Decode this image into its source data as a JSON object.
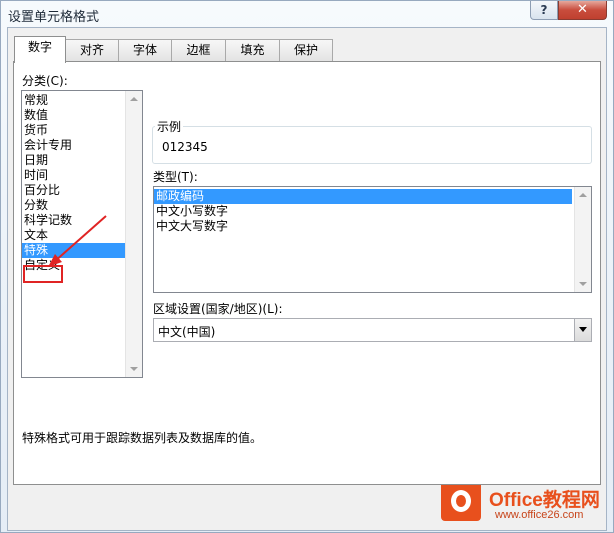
{
  "window": {
    "title": "设置单元格格式",
    "help_glyph": "?",
    "close_glyph": "✕"
  },
  "tabs": [
    {
      "label": "数字",
      "active": true
    },
    {
      "label": "对齐"
    },
    {
      "label": "字体"
    },
    {
      "label": "边框"
    },
    {
      "label": "填充"
    },
    {
      "label": "保护"
    }
  ],
  "category": {
    "label": "分类(C):",
    "items": [
      "常规",
      "数值",
      "货币",
      "会计专用",
      "日期",
      "时间",
      "百分比",
      "分数",
      "科学记数",
      "文本",
      "特殊",
      "自定义"
    ],
    "selected": "特殊"
  },
  "sample": {
    "label": "示例",
    "value": "012345"
  },
  "type": {
    "label": "类型(T):",
    "items": [
      "邮政编码",
      "中文小写数字",
      "中文大写数字"
    ],
    "selected": "邮政编码"
  },
  "locale": {
    "label": "区域设置(国家/地区)(L):",
    "value": "中文(中国)"
  },
  "description": "特殊格式可用于跟踪数据列表及数据库的值。",
  "watermark": {
    "brand": "Office教程网",
    "url": "www.office26.com"
  },
  "colors": {
    "selection": "#3399ff",
    "annotation": "#e02424",
    "brand": "#e8501d"
  }
}
